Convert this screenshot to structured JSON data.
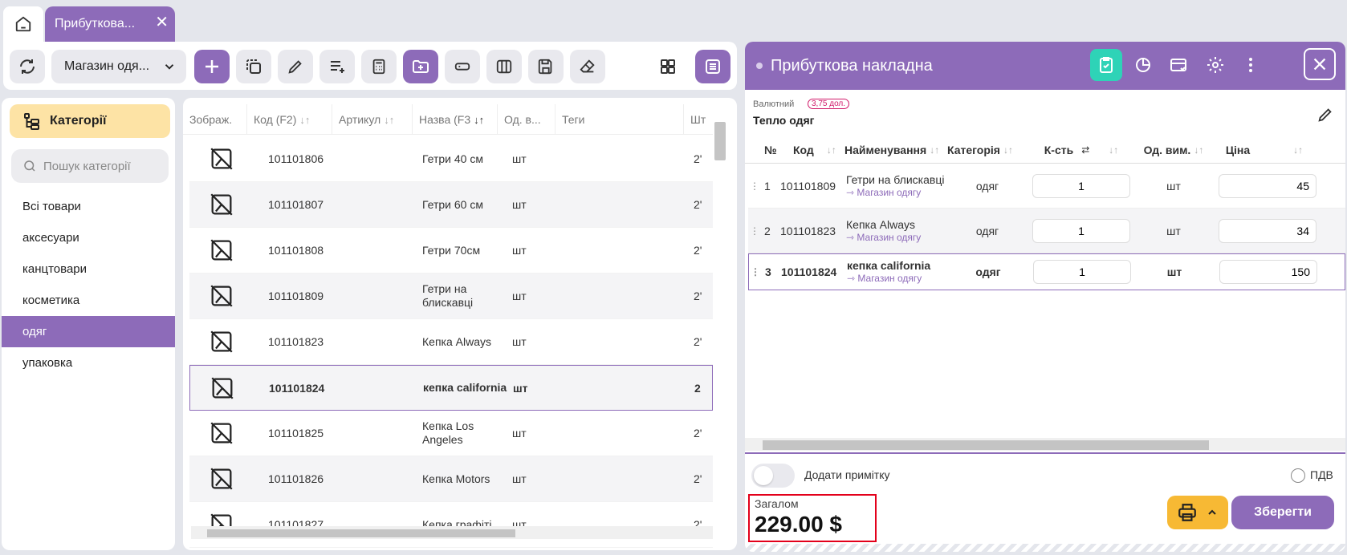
{
  "tabs": {
    "home_icon": "home-icon",
    "document_tab": "Прибуткова...",
    "close_icon": "close-icon"
  },
  "toolbar": {
    "store_select": "Магазин одя...",
    "buttons": [
      "refresh-icon",
      "plus-icon",
      "copy-icon",
      "pencil-icon",
      "add-list-icon",
      "calculator-icon",
      "add-folder-icon",
      "label-icon",
      "columns-icon",
      "save-icon",
      "eraser-icon",
      "grid-view-icon",
      "list-view-icon"
    ]
  },
  "categories": {
    "button_label": "Категорії",
    "search_placeholder": "Пошук категорії",
    "items": [
      "Всі товари",
      "аксесуари",
      "канцтовари",
      "косметика",
      "одяг",
      "упаковка"
    ],
    "active_index": 4
  },
  "products": {
    "columns": [
      "Зображ.",
      "Код (F2)",
      "Артикул",
      "Назва (F3",
      "Од. в...",
      "Теги",
      "Шт"
    ],
    "rows": [
      {
        "code": "101101806",
        "name": "Гетри 40 см",
        "unit": "шт",
        "extra": "2'"
      },
      {
        "code": "101101807",
        "name": "Гетри 60 см",
        "unit": "шт",
        "extra": "2'"
      },
      {
        "code": "101101808",
        "name": "Гетри 70см",
        "unit": "шт",
        "extra": "2'"
      },
      {
        "code": "101101809",
        "name": "Гетри на блискавці",
        "unit": "шт",
        "extra": "2'"
      },
      {
        "code": "101101823",
        "name": "Кепка Always",
        "unit": "шт",
        "extra": "2'"
      },
      {
        "code": "101101824",
        "name": "кепка california",
        "unit": "шт",
        "extra": "2"
      },
      {
        "code": "101101825",
        "name": "Кепка Los Angeles",
        "unit": "шт",
        "extra": "2'"
      },
      {
        "code": "101101826",
        "name": "Кепка Motors",
        "unit": "шт",
        "extra": "2'"
      },
      {
        "code": "101101827",
        "name": "Кепка графіті",
        "unit": "шт",
        "extra": "2'"
      }
    ],
    "selected_index": 5
  },
  "document": {
    "title": "Прибуткова накладна",
    "currency_label": "Валютний",
    "currency_badge": "3,75 дол.",
    "supplier": "Тепло одяг",
    "columns": [
      "№",
      "Код",
      "Найменування",
      "Категорія",
      "К-сть",
      "Од. вим.",
      "Ціна"
    ],
    "rows": [
      {
        "num": "1",
        "code": "101101809",
        "name": "Гетри на блискавці",
        "store": "⇾ Магазин одягу",
        "category": "одяг",
        "qty": "1",
        "unit": "шт",
        "price": "45"
      },
      {
        "num": "2",
        "code": "101101823",
        "name": "Кепка Always",
        "store": "⇾ Магазин одягу",
        "category": "одяг",
        "qty": "1",
        "unit": "шт",
        "price": "34"
      },
      {
        "num": "3",
        "code": "101101824",
        "name": "кепка california",
        "store": "⇾ Магазин одягу",
        "category": "одяг",
        "qty": "1",
        "unit": "шт",
        "price": "150"
      }
    ],
    "selected_index": 2,
    "note_label": "Додати примітку",
    "vat_label": "ПДВ",
    "total_label": "Загалом",
    "total_value": "229.00 $",
    "save_label": "Зберегти",
    "colors": {
      "accent": "#8d6bb9",
      "teal": "#2ed3b7",
      "yellow": "#f7b934",
      "highlight": "#e3001b"
    }
  }
}
